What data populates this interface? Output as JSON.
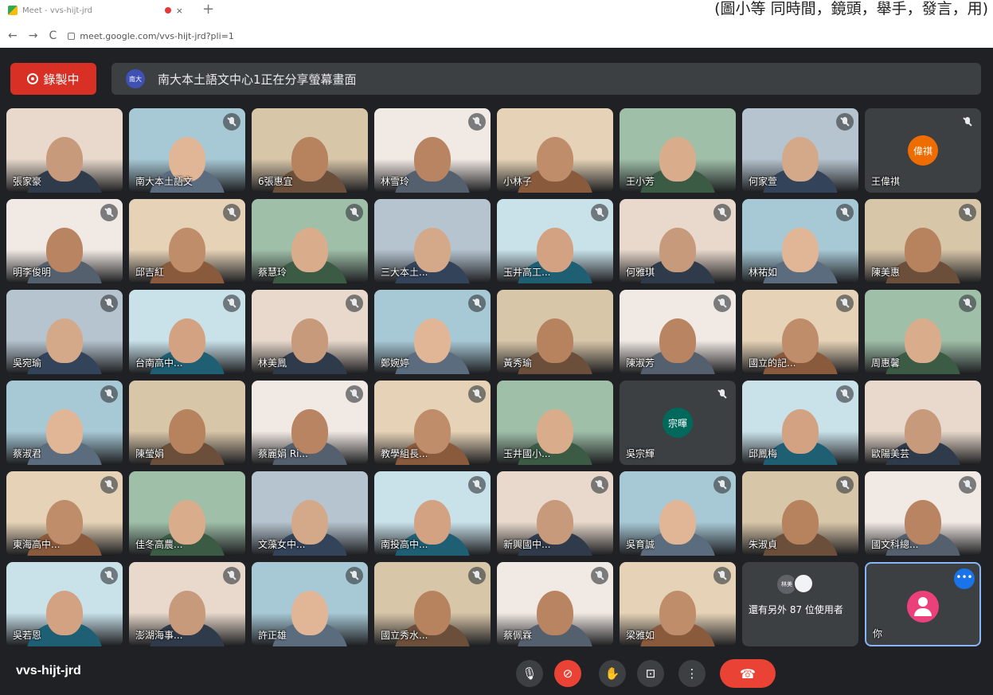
{
  "browser": {
    "tab_title": "Meet - vvs-hijt-jrd",
    "close_glyph": "×",
    "new_tab_glyph": "+",
    "url": "meet.google.com/vvs-hijt-jrd?pli=1",
    "corner_caption": "(圖小等 同時間，鏡頭，舉手，發言，用)",
    "back_glyph": "←",
    "forward_glyph": "→",
    "reload_glyph": "C"
  },
  "banner": {
    "recording_label": "錄製中",
    "presenter_avatar": "南大",
    "sharing_text": "南大本土語文中心1正在分享螢幕畫面"
  },
  "participants": [
    {
      "name": "張家豪",
      "muted": false
    },
    {
      "name": "南大本土語文",
      "muted": true
    },
    {
      "name": "6張惠宜",
      "muted": false
    },
    {
      "name": "林雪玲",
      "muted": true
    },
    {
      "name": "小林子",
      "muted": false
    },
    {
      "name": "王小芳",
      "muted": false
    },
    {
      "name": "何家萱",
      "muted": true
    },
    {
      "name": "王偉祺",
      "muted": true,
      "initial": "偉祺"
    },
    {
      "name": "明李俊明",
      "muted": true
    },
    {
      "name": "邱吉紅",
      "muted": true
    },
    {
      "name": "蔡慧玲",
      "muted": true
    },
    {
      "name": "三大本土...",
      "muted": false
    },
    {
      "name": "玉井高工...",
      "muted": true
    },
    {
      "name": "何雅琪",
      "muted": true
    },
    {
      "name": "林祐如",
      "muted": true
    },
    {
      "name": "陳美惠",
      "muted": true
    },
    {
      "name": "吳宛瑜",
      "muted": true
    },
    {
      "name": "台南高中...",
      "muted": true
    },
    {
      "name": "林美鳳",
      "muted": true
    },
    {
      "name": "鄭婉婷",
      "muted": true
    },
    {
      "name": "黃秀瑜",
      "muted": false
    },
    {
      "name": "陳淑芳",
      "muted": true
    },
    {
      "name": "國立的記...",
      "muted": true
    },
    {
      "name": "周惠馨",
      "muted": true
    },
    {
      "name": "蔡淑君",
      "muted": true
    },
    {
      "name": "陳瑩娟",
      "muted": false
    },
    {
      "name": "蔡麗娟 Ri...",
      "muted": true
    },
    {
      "name": "教學組長...",
      "muted": true
    },
    {
      "name": "玉井國小...",
      "muted": false
    },
    {
      "name": "吳宗輝",
      "muted": true,
      "initial": "宗暉"
    },
    {
      "name": "邱鳳梅",
      "muted": true
    },
    {
      "name": "歐陽美芸",
      "muted": false
    },
    {
      "name": "東海高中...",
      "muted": true
    },
    {
      "name": "佳冬高農...",
      "muted": false
    },
    {
      "name": "文藻女中...",
      "muted": false
    },
    {
      "name": "南投高中...",
      "muted": true
    },
    {
      "name": "新興國中...",
      "muted": true
    },
    {
      "name": "吳育誠",
      "muted": true
    },
    {
      "name": "朱淑貞",
      "muted": true
    },
    {
      "name": "國文科總...",
      "muted": true
    },
    {
      "name": "吳若恩",
      "muted": true
    },
    {
      "name": "澎湖海事...",
      "muted": true
    },
    {
      "name": "許正雄",
      "muted": true
    },
    {
      "name": "國立秀水...",
      "muted": true
    },
    {
      "name": "蔡佩霖",
      "muted": true
    },
    {
      "name": "梁雅如",
      "muted": true
    }
  ],
  "more": {
    "avatar": "林美",
    "label": "還有另外 87 位使用者"
  },
  "self": {
    "name": "你",
    "menu": "•••"
  },
  "controls": {
    "meeting_code": "vvs-hijt-jrd",
    "mic": "🎙",
    "camera": "⊘",
    "raise_hand": "✋",
    "present": "⊡",
    "more": "⋮",
    "hangup": "☎"
  }
}
